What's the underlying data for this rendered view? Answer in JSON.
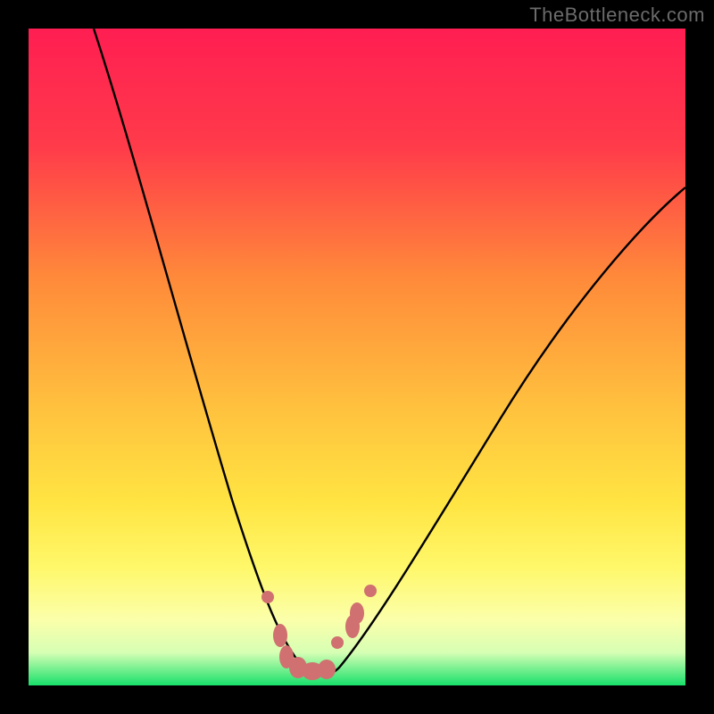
{
  "watermark": "TheBottleneck.com",
  "chart_data": {
    "type": "line",
    "title": "",
    "xlabel": "",
    "ylabel": "",
    "xlim": [
      0,
      100
    ],
    "ylim": [
      0,
      100
    ],
    "grid": false,
    "legend": false,
    "series": [
      {
        "name": "bottleneck-curve",
        "x": [
          10,
          14,
          18,
          22,
          26,
          30,
          34,
          38,
          40,
          42,
          44,
          46,
          50,
          56,
          62,
          70,
          80,
          90,
          100
        ],
        "y": [
          100,
          84,
          68,
          54,
          40,
          28,
          18,
          8,
          4,
          2,
          2,
          4,
          8,
          16,
          24,
          34,
          46,
          58,
          68
        ]
      }
    ],
    "annotations": {
      "optimal_band_y": [
        0,
        3
      ],
      "markers": [
        {
          "x": 36,
          "y": 12,
          "shape": "circle"
        },
        {
          "x": 38,
          "y": 6,
          "shape": "ellipse"
        },
        {
          "x": 39,
          "y": 3,
          "shape": "ellipse"
        },
        {
          "x": 41,
          "y": 2,
          "shape": "ellipse"
        },
        {
          "x": 43,
          "y": 2,
          "shape": "ellipse"
        },
        {
          "x": 45,
          "y": 2,
          "shape": "ellipse"
        },
        {
          "x": 47,
          "y": 6,
          "shape": "circle"
        },
        {
          "x": 49,
          "y": 8,
          "shape": "ellipse"
        },
        {
          "x": 50,
          "y": 10,
          "shape": "ellipse"
        },
        {
          "x": 52,
          "y": 14,
          "shape": "circle"
        }
      ]
    },
    "colors": {
      "frame": "#000000",
      "curve": "#000000",
      "marker": "#d07070",
      "gradient_top": "#ff1e52",
      "gradient_mid_upper": "#ff8a3a",
      "gradient_mid": "#ffe442",
      "gradient_lower": "#fffb8a",
      "gradient_band": "#f4ffc8",
      "gradient_bottom": "#18e06b"
    }
  }
}
